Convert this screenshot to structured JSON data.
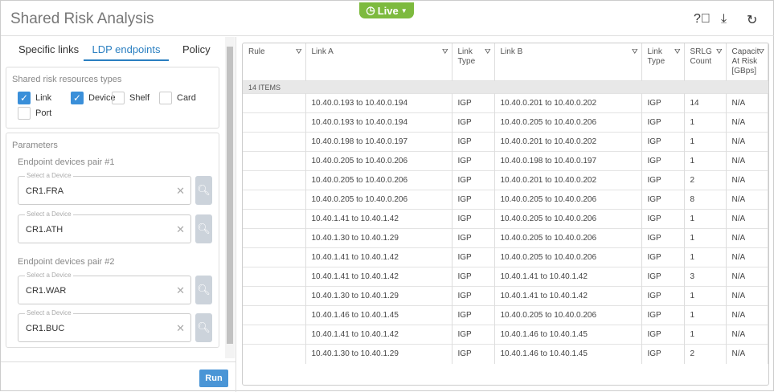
{
  "header": {
    "title": "Shared Risk Analysis",
    "live_label": "Live"
  },
  "tabs": [
    "Specific links",
    "LDP endpoints",
    "Policy"
  ],
  "resources": {
    "label": "Shared risk resources types",
    "options": [
      {
        "label": "Link",
        "checked": true
      },
      {
        "label": "Device",
        "checked": true
      },
      {
        "label": "Shelf",
        "checked": false
      },
      {
        "label": "Card",
        "checked": false
      },
      {
        "label": "Port",
        "checked": false
      }
    ]
  },
  "parameters": {
    "label": "Parameters",
    "pair1_label": "Endpoint devices pair #1",
    "pair2_label": "Endpoint devices pair #2",
    "placeholder": "Select a Device",
    "devices": [
      "CR1.FRA",
      "CR1.ATH",
      "CR1.WAR",
      "CR1.BUC"
    ]
  },
  "run_label": "Run",
  "table": {
    "columns": [
      "Rule",
      "Link A",
      "Link\nType",
      "Link B",
      "Link\nType",
      "SRLG\nCount",
      "Capacit\nAt Risk\n[GBps]"
    ],
    "items_label": "14 ITEMS",
    "rows": [
      [
        "",
        "10.40.0.193 to 10.40.0.194",
        "IGP",
        "10.40.0.201 to 10.40.0.202",
        "IGP",
        "14",
        "N/A"
      ],
      [
        "",
        "10.40.0.193 to 10.40.0.194",
        "IGP",
        "10.40.0.205 to 10.40.0.206",
        "IGP",
        "1",
        "N/A"
      ],
      [
        "",
        "10.40.0.198 to 10.40.0.197",
        "IGP",
        "10.40.0.201 to 10.40.0.202",
        "IGP",
        "1",
        "N/A"
      ],
      [
        "",
        "10.40.0.205 to 10.40.0.206",
        "IGP",
        "10.40.0.198 to 10.40.0.197",
        "IGP",
        "1",
        "N/A"
      ],
      [
        "",
        "10.40.0.205 to 10.40.0.206",
        "IGP",
        "10.40.0.201 to 10.40.0.202",
        "IGP",
        "2",
        "N/A"
      ],
      [
        "",
        "10.40.0.205 to 10.40.0.206",
        "IGP",
        "10.40.0.205 to 10.40.0.206",
        "IGP",
        "8",
        "N/A"
      ],
      [
        "",
        "10.40.1.41 to 10.40.1.42",
        "IGP",
        "10.40.0.205 to 10.40.0.206",
        "IGP",
        "1",
        "N/A"
      ],
      [
        "",
        "10.40.1.30 to 10.40.1.29",
        "IGP",
        "10.40.0.205 to 10.40.0.206",
        "IGP",
        "1",
        "N/A"
      ],
      [
        "",
        "10.40.1.41 to 10.40.1.42",
        "IGP",
        "10.40.0.205 to 10.40.0.206",
        "IGP",
        "1",
        "N/A"
      ],
      [
        "",
        "10.40.1.41 to 10.40.1.42",
        "IGP",
        "10.40.1.41 to 10.40.1.42",
        "IGP",
        "3",
        "N/A"
      ],
      [
        "",
        "10.40.1.30 to 10.40.1.29",
        "IGP",
        "10.40.1.41 to 10.40.1.42",
        "IGP",
        "1",
        "N/A"
      ],
      [
        "",
        "10.40.1.46 to 10.40.1.45",
        "IGP",
        "10.40.0.205 to 10.40.0.206",
        "IGP",
        "1",
        "N/A"
      ],
      [
        "",
        "10.40.1.41 to 10.40.1.42",
        "IGP",
        "10.40.1.46 to 10.40.1.45",
        "IGP",
        "1",
        "N/A"
      ],
      [
        "",
        "10.40.1.30 to 10.40.1.29",
        "IGP",
        "10.40.1.46 to 10.40.1.45",
        "IGP",
        "2",
        "N/A"
      ]
    ]
  }
}
